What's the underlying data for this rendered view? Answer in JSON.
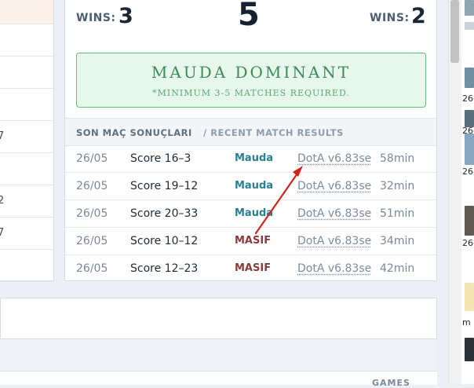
{
  "left_column": {
    "fragments": [
      "",
      "",
      "",
      "7",
      "",
      "2",
      "7",
      ""
    ]
  },
  "scoreboard": {
    "left_wins_label": "WINS:",
    "left_wins": "3",
    "total": "5",
    "right_wins_label": "WINS:",
    "right_wins": "2"
  },
  "dominant_banner": {
    "title": "MAUDA DOMINANT",
    "subtitle": "*MINIMUM 3-5 MATCHES REQUIRED."
  },
  "recent_results": {
    "heading_tr": "SON MAÇ SONUÇLARI",
    "heading_en": "/ RECENT MATCH RESULTS",
    "rows": [
      {
        "date": "26/05",
        "score": "Score 16–3",
        "team": "Mauda",
        "game": "DotA v6.83se",
        "duration": "58min"
      },
      {
        "date": "26/05",
        "score": "Score 19–12",
        "team": "Mauda",
        "game": "DotA v6.83se",
        "duration": "32min"
      },
      {
        "date": "26/05",
        "score": "Score 20–33",
        "team": "Mauda",
        "game": "DotA v6.83se",
        "duration": "51min"
      },
      {
        "date": "26/05",
        "score": "Score 10–12",
        "team": "MASIF",
        "game": "DotA v6.83se",
        "duration": "34min"
      },
      {
        "date": "26/05",
        "score": "Score 12–23",
        "team": "MASIF",
        "game": "DotA v6.83se",
        "duration": "42min"
      }
    ]
  },
  "lower": {
    "games_label": "GAMES"
  },
  "sidebar_fragments": [
    "26-",
    "26-",
    "26-",
    "26-",
    "m"
  ],
  "colors": {
    "mauda": "#2b7f8f",
    "masif": "#8c3b3b",
    "banner_border": "#5fc27b",
    "arrow": "#d0241b"
  }
}
